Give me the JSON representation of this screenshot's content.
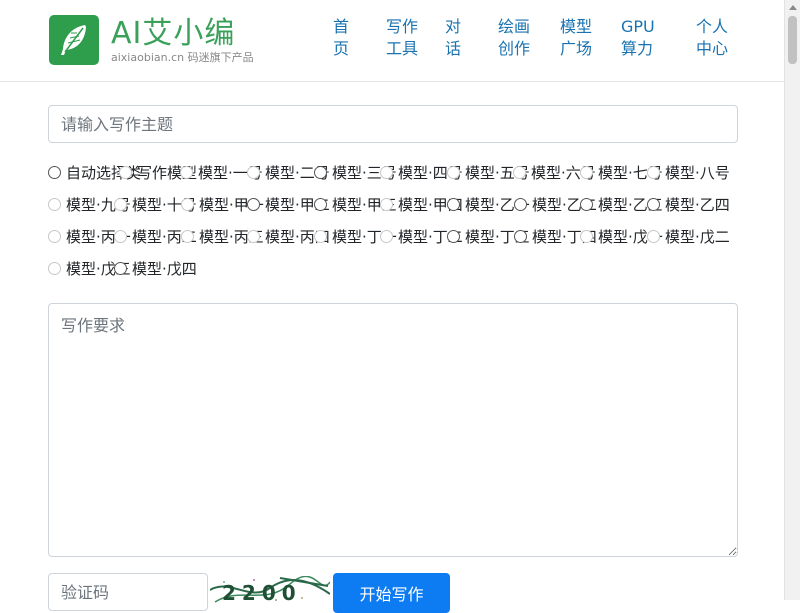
{
  "brand": {
    "title": "AI艾小编",
    "subtitle": "aixiaobian.cn 码迷旗下产品",
    "icon": "feather-icon"
  },
  "nav": {
    "items": [
      {
        "label": "首页"
      },
      {
        "label": "写作工具"
      },
      {
        "label": "对话"
      },
      {
        "label": "绘画创作"
      },
      {
        "label": "模型广场"
      },
      {
        "label": "GPU算力"
      },
      {
        "label": "个人中心"
      }
    ]
  },
  "form": {
    "search_placeholder": "请输入写作主题",
    "radio_options": [
      {
        "label": "自动选择类",
        "disabled": false
      },
      {
        "label": "写作模型",
        "disabled": true
      },
      {
        "label": "模型·一号",
        "disabled": true
      },
      {
        "label": "模型·二号",
        "disabled": true
      },
      {
        "label": "模型·三号",
        "disabled": false
      },
      {
        "label": "模型·四号",
        "disabled": true
      },
      {
        "label": "模型·五号",
        "disabled": true
      },
      {
        "label": "模型·六号",
        "disabled": true
      },
      {
        "label": "模型·七号",
        "disabled": true
      },
      {
        "label": "模型·八号",
        "disabled": true
      },
      {
        "label": "模型·九号",
        "disabled": true
      },
      {
        "label": "模型·十号",
        "disabled": true
      },
      {
        "label": "模型·甲一",
        "disabled": true
      },
      {
        "label": "模型·甲二",
        "disabled": false
      },
      {
        "label": "模型·甲三",
        "disabled": false
      },
      {
        "label": "模型·甲四",
        "disabled": true
      },
      {
        "label": "模型·乙一",
        "disabled": false
      },
      {
        "label": "模型·乙二",
        "disabled": false
      },
      {
        "label": "模型·乙三",
        "disabled": false
      },
      {
        "label": "模型·乙四",
        "disabled": false
      },
      {
        "label": "模型·丙一",
        "disabled": true
      },
      {
        "label": "模型·丙二",
        "disabled": true
      },
      {
        "label": "模型·丙三",
        "disabled": true
      },
      {
        "label": "模型·丙四",
        "disabled": true
      },
      {
        "label": "模型·丁一",
        "disabled": true
      },
      {
        "label": "模型·丁二",
        "disabled": true
      },
      {
        "label": "模型·丁三",
        "disabled": false
      },
      {
        "label": "模型·丁四",
        "disabled": false
      },
      {
        "label": "模型·戊一",
        "disabled": true
      },
      {
        "label": "模型·戊二",
        "disabled": true
      },
      {
        "label": "模型·戊三",
        "disabled": true
      },
      {
        "label": "模型·戊四",
        "disabled": false
      }
    ],
    "textarea_placeholder": "写作要求",
    "captcha_placeholder": "验证码",
    "captcha_text": "2200",
    "submit_label": "开始写作"
  },
  "colors": {
    "brand_green": "#2e9e4c",
    "link_blue": "#1a73b0",
    "button_blue": "#0d7cf2"
  }
}
